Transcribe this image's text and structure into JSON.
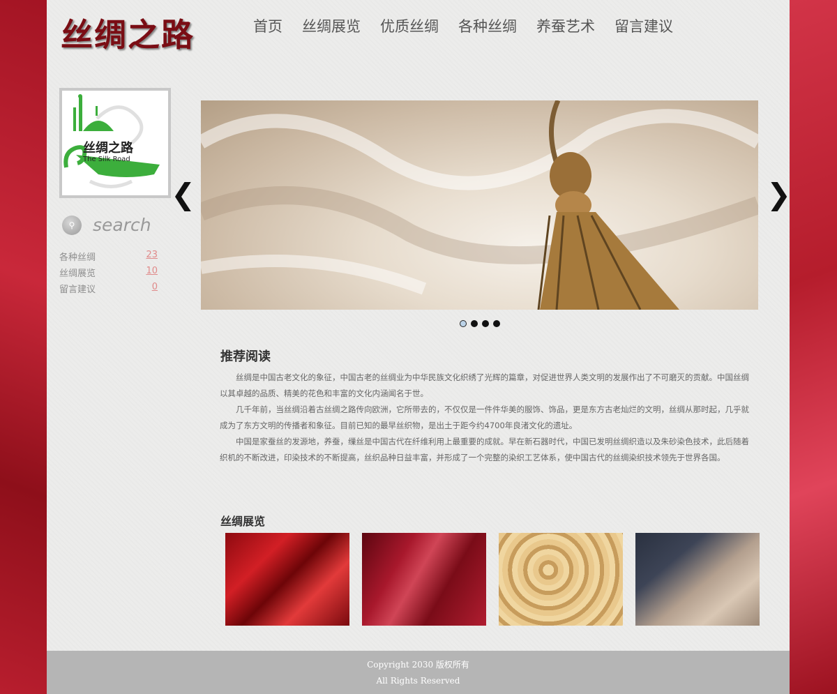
{
  "brand": {
    "title": "丝绸之路"
  },
  "nav": {
    "items": [
      "首页",
      "丝绸展览",
      "优质丝绸",
      "各种丝绸",
      "养蚕艺术",
      "留言建议"
    ]
  },
  "sidebar": {
    "logo_text_cn": "丝绸之路",
    "logo_text_en": "The Silk Road",
    "search_placeholder": "search",
    "categories": [
      {
        "name": "各种丝绸",
        "count": "23"
      },
      {
        "name": "丝绸展览",
        "count": "10"
      },
      {
        "name": "留言建议",
        "count": "0"
      }
    ]
  },
  "slider": {
    "slide_count": 4,
    "active_index": 0
  },
  "reading": {
    "title": "推荐阅读",
    "paragraphs": [
      "丝绸是中国古老文化的象征，中国古老的丝绸业为中华民族文化织绣了光辉的篇章，对促进世界人类文明的发展作出了不可磨灭的贡献。中国丝绸以其卓越的品质、精美的花色和丰富的文化内涵闻名于世。",
      "几千年前，当丝绸沿着古丝绸之路传向欧洲，它所带去的，不仅仅是一件件华美的服饰、饰品，更是东方古老灿烂的文明，丝绸从那时起，几乎就成为了东方文明的传播者和象征。目前已知的最早丝织物，是出土于距今约4700年良渚文化的遗址。",
      "中国是家蚕丝的发源地，养蚕，缫丝是中国古代在纤维利用上最重要的成就。早在新石器时代，中国已发明丝绸织造以及朱砂染色技术，此后随着织机的不断改进，印染技术的不断提高，丝织品种日益丰富，并形成了一个完整的染织工艺体系，使中国古代的丝绸染织技术领先于世界各国。"
    ]
  },
  "gallery": {
    "title": "丝绸展览"
  },
  "footer": {
    "line1": "Copyright 2030 版权所有",
    "line2": "All Rights Reserved"
  }
}
